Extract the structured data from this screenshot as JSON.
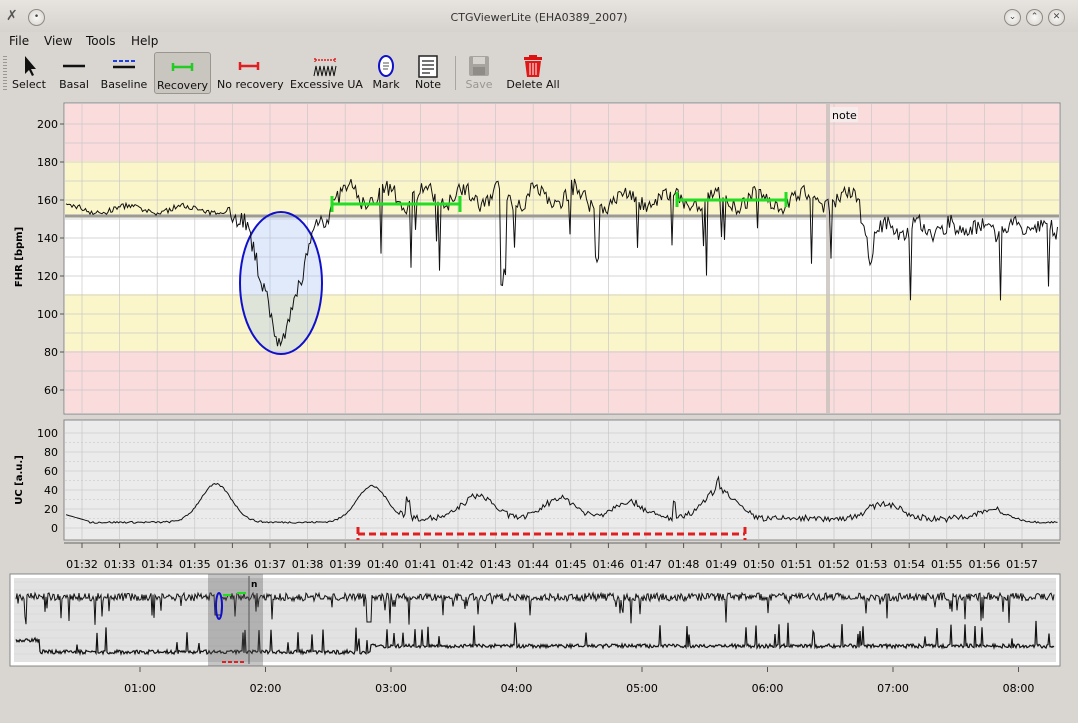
{
  "window": {
    "title": "CTGViewerLite (EHA0389_2007)"
  },
  "menu": [
    "File",
    "View",
    "Tools",
    "Help"
  ],
  "toolbar": [
    {
      "label": "Select",
      "icon": "cursor-icon"
    },
    {
      "label": "Basal",
      "icon": "basal-line-icon"
    },
    {
      "label": "Baseline",
      "icon": "baseline-icon"
    },
    {
      "label": "Recovery",
      "icon": "recovery-icon",
      "active": true
    },
    {
      "label": "No recovery",
      "icon": "no-recovery-icon"
    },
    {
      "label": "Excessive UA",
      "icon": "excessive-ua-icon"
    },
    {
      "label": "Mark",
      "icon": "mark-ellipse-icon"
    },
    {
      "label": "Note",
      "icon": "note-icon"
    },
    {
      "label": "Save",
      "icon": "save-icon",
      "disabled": true
    },
    {
      "label": "Delete All",
      "icon": "trash-icon"
    }
  ],
  "fhr_panel": {
    "ylabel": "FHR [bpm]",
    "yticks": [
      "200",
      "180",
      "160",
      "140",
      "120",
      "100",
      "80",
      "60"
    ],
    "note_label": "note"
  },
  "uc_panel": {
    "ylabel": "UC [a.u.]",
    "yticks": [
      "100",
      "80",
      "60",
      "40",
      "20",
      "0"
    ]
  },
  "time_axis": [
    "01:32",
    "01:33",
    "01:34",
    "01:35",
    "01:36",
    "01:37",
    "01:38",
    "01:39",
    "01:40",
    "01:41",
    "01:42",
    "01:43",
    "01:44",
    "01:45",
    "01:46",
    "01:47",
    "01:48",
    "01:49",
    "01:50",
    "01:51",
    "01:52",
    "01:53",
    "01:54",
    "01:55",
    "01:56",
    "01:57"
  ],
  "overview": {
    "marker": "n",
    "time_axis": [
      "01:00",
      "02:00",
      "03:00",
      "04:00",
      "05:00",
      "06:00",
      "07:00",
      "08:00"
    ]
  },
  "colors": {
    "danger_band": "#fbdcdc",
    "warn_band": "#fbf6c9",
    "recovery": "#22dd22",
    "no_recovery": "#e02020",
    "mark": "#1010cc"
  }
}
